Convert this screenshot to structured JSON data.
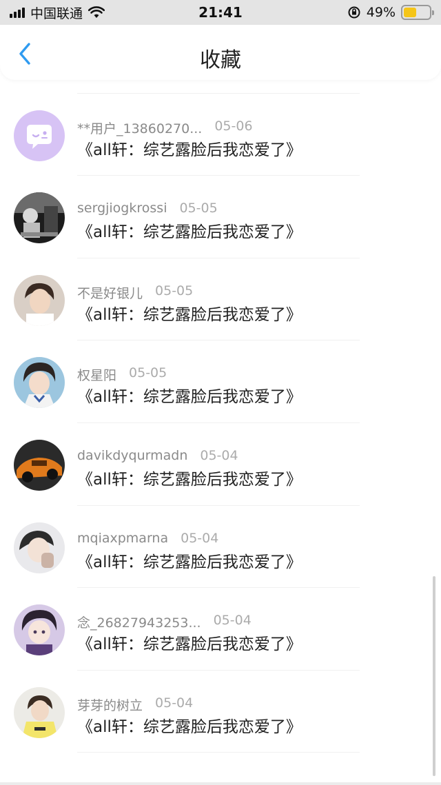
{
  "status_bar": {
    "carrier": "中国联通",
    "time": "21:41",
    "battery": "49%",
    "battery_level": 0.49,
    "icons": [
      "signal-icon",
      "wifi-icon",
      "rotation-lock-icon",
      "battery-icon"
    ]
  },
  "nav": {
    "title": "收藏",
    "back_icon": "chevron-left-icon"
  },
  "items": [
    {
      "user": "",
      "date": "",
      "title": "《all轩：综艺露脸后我恋爱了》",
      "avatar": "default"
    },
    {
      "user": "**用户_13860270...",
      "date": "05-06",
      "title": "《all轩：综艺露脸后我恋爱了》",
      "avatar": "default"
    },
    {
      "user": "sergjiogkrossi",
      "date": "05-05",
      "title": "《all轩：综艺露脸后我恋爱了》",
      "avatar": "photo-dark"
    },
    {
      "user": "不是好银儿",
      "date": "05-05",
      "title": "《all轩：综艺露脸后我恋爱了》",
      "avatar": "photo-boy"
    },
    {
      "user": "权星阳",
      "date": "05-05",
      "title": "《all轩：综艺露脸后我恋爱了》",
      "avatar": "photo-girl"
    },
    {
      "user": "davikdyqurmadn",
      "date": "05-04",
      "title": "《all轩：综艺露脸后我恋爱了》",
      "avatar": "photo-car"
    },
    {
      "user": "mqiaxpmarna",
      "date": "05-04",
      "title": "《all轩：综艺露脸后我恋爱了》",
      "avatar": "photo-portrait"
    },
    {
      "user": "念_26827943253...",
      "date": "05-04",
      "title": "《all轩：综艺露脸后我恋爱了》",
      "avatar": "photo-cartoon"
    },
    {
      "user": "芽芽的树立",
      "date": "05-04",
      "title": "《all轩：综艺露脸后我恋爱了》",
      "avatar": "photo-yellow"
    }
  ],
  "colors": {
    "accent": "#2f9bf0",
    "default_avatar": "#d7c3f5",
    "status_bar_bg": "#e4e4e4",
    "battery_fill": "#f5c518"
  }
}
